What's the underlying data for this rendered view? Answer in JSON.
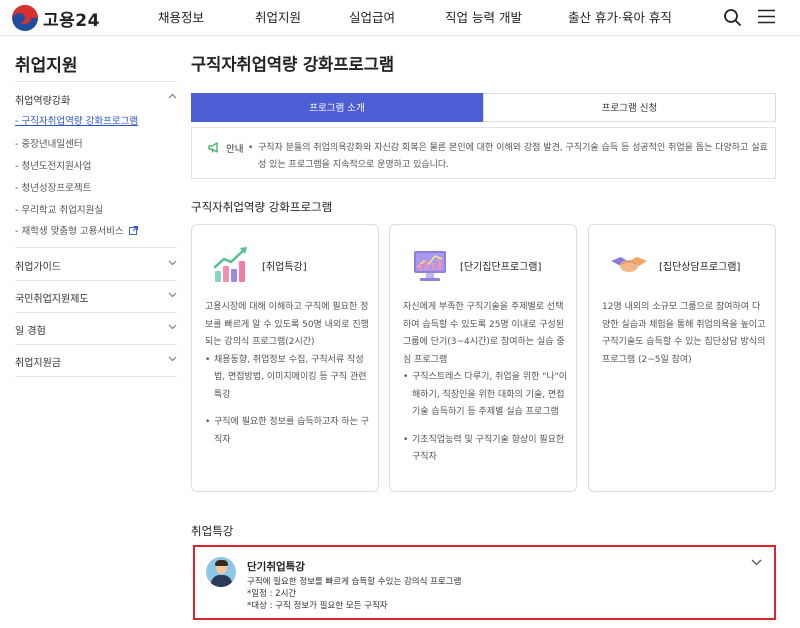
{
  "header": {
    "logo_text": "고용24",
    "nav": [
      "채용정보",
      "취업지원",
      "실업급여",
      "직업 능력 개발",
      "출산 휴가·육아 휴직"
    ],
    "icons": [
      "search-icon",
      "menu-icon"
    ]
  },
  "sidebar": {
    "title": "취업지원",
    "groups": [
      {
        "label": "취업역량강화",
        "expanded": true,
        "items": [
          {
            "label": "- 구직자취업역량 강화프로그램",
            "active": true
          },
          {
            "label": "- 중장년내일센터"
          },
          {
            "label": "- 청년도전지원사업"
          },
          {
            "label": "- 청년성장프로젝트"
          },
          {
            "label": "- 우리학교 취업지원실"
          },
          {
            "label": "- 재학생 맞춤형 고용서비스",
            "external": true
          }
        ]
      },
      {
        "label": "취업가이드"
      },
      {
        "label": "국민취업지원제도"
      },
      {
        "label": "일 경험"
      },
      {
        "label": "취업지원금"
      }
    ]
  },
  "main": {
    "title": "구직자취업역량 강화프로그램",
    "tabs": [
      {
        "label": "프로그램 소개",
        "selected": true
      },
      {
        "label": "프로그램 신청",
        "selected": false
      }
    ],
    "notice": {
      "label": "안내",
      "text": "구직자 분들의 취업의욕강화와 자신감 회복은 물론 본인에 대한 이해와 강점 발견, 구직기술 습득 등 성공적인 취업을 돕는 다양하고 실효성 있는 프로그램을 지속적으로 운영하고 있습니다."
    },
    "programs_section_title": "구직자취업역량 강화프로그램",
    "cards": [
      {
        "name": "[취업특강]",
        "icon": "chart-growth-icon",
        "desc": "고용시장에 대해 이해하고 구직에 필요한 정보를 빠르게 알 수 있도록 50명 내외로 진행되는 강의식 프로그램(2시간)",
        "bullets": [
          "채용동향, 취업정보 수집, 구직서류 작성법, 면접방법, 이미지메이킹 등 구직 관련 특강",
          "구직에 필요한 정보를 습득하고자 하는 구직자"
        ]
      },
      {
        "name": "[단기집단프로그램]",
        "icon": "monitor-chart-icon",
        "desc": "자신에게 부족한 구직기술을 주제별로 선택하여 습득할 수 있도록 25명 이내로 구성된 그룹에 단기(3~4시간)로 참여하는 실습 중심 프로그램",
        "bullets": [
          "구직스트레스 다루기, 취업을 위한 \"나\"이해하기, 직장인을 위한 대화의 기술, 면접기술 습득하기 등 주제별 실습 프로그램",
          "기초직업능력 및 구직기술 향상이 필요한 구직자"
        ]
      },
      {
        "name": "[집단상담프로그램]",
        "icon": "handshake-icon",
        "desc": "12명 내외의 소규모 그룹으로 참여하여 다양한 실습과 체험을 통해 취업의욕을 높이고 구직기술도 습득할 수 있는 집단상담 방식의 프로그램 (2~5일 참여)",
        "bullets": []
      }
    ],
    "lecture_section_title": "취업특강",
    "lecture": {
      "title": "단기취업특강",
      "desc": "구직에 필요한 정보를 빠르게 습득할 수있는 강의식 프로그램",
      "schedule": "*일정 : 2시간",
      "target": "*대상 : 구직 정보가 필요한 모든 구직자"
    }
  },
  "colors": {
    "accent": "#4c5fd5",
    "link": "#2a56c6",
    "highlight_border": "#d9262d"
  }
}
